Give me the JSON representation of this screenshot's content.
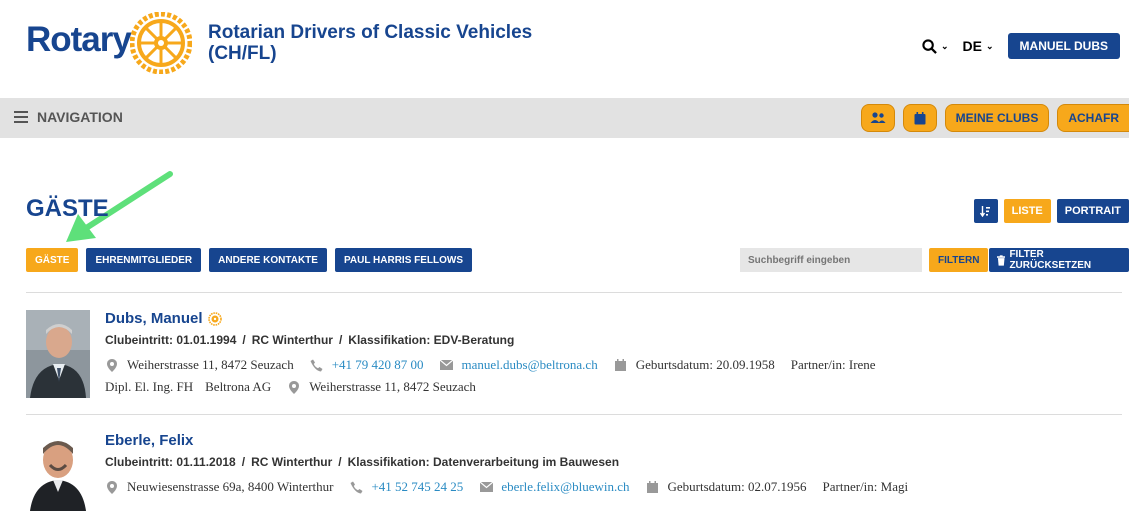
{
  "header": {
    "logo_text": "Rotary",
    "title_line1": "Rotarian Drivers of Classic Vehicles",
    "title_line2": "(CH/FL)",
    "search_icon": "search-icon",
    "language": "DE",
    "user_button": "MANUEL DUBS"
  },
  "navbar": {
    "toggle_label": "NAVIGATION",
    "buttons": [
      {
        "icon": "people-icon"
      },
      {
        "icon": "calendar-icon"
      },
      {
        "label": "MEINE CLUBS"
      },
      {
        "label": "ACHAFR"
      }
    ]
  },
  "page": {
    "title": "GÄSTE",
    "view": {
      "sort_icon": "sort-icon",
      "list_label": "LISTE",
      "portrait_label": "PORTRAIT"
    },
    "tabs": [
      {
        "label": "GÄSTE",
        "active": true
      },
      {
        "label": "EHRENMITGLIEDER",
        "active": false
      },
      {
        "label": "ANDERE KONTAKTE",
        "active": false
      },
      {
        "label": "PAUL HARRIS FELLOWS",
        "active": false
      }
    ],
    "search_placeholder": "Suchbegriff eingeben",
    "filter_label": "FILTERN",
    "reset_label": "FILTER ZURÜCKSETZEN"
  },
  "members": [
    {
      "name": "Dubs, Manuel",
      "entry": "Clubeintritt: 01.01.1994",
      "club": "RC Winterthur",
      "classification": "Klassifikation: EDV-Beratung",
      "address": "Weiherstrasse 11, 8472 Seuzach",
      "phone": "+41 79 420 87 00",
      "email": "manuel.dubs@beltrona.ch",
      "birthdate": "Geburtsdatum: 20.09.1958",
      "partner": "Partner/in: Irene",
      "title": "Dipl. El. Ing. FH",
      "company": "Beltrona AG",
      "business_address": "Weiherstrasse 11, 8472 Seuzach"
    },
    {
      "name": "Eberle, Felix",
      "entry": "Clubeintritt: 01.11.2018",
      "club": "RC Winterthur",
      "classification": "Klassifikation: Datenverarbeitung im Bauwesen",
      "address": "Neuwiesenstrasse 69a, 8400 Winterthur",
      "phone": "+41 52 745 24 25",
      "email": "eberle.felix@bluewin.ch",
      "birthdate": "Geburtsdatum: 02.07.1956",
      "partner": "Partner/in: Magi"
    }
  ],
  "colors": {
    "brand_blue": "#17458f",
    "accent_gold": "#f7a81b",
    "link": "#2a8bc3",
    "arrow_green": "#5ee07a"
  }
}
